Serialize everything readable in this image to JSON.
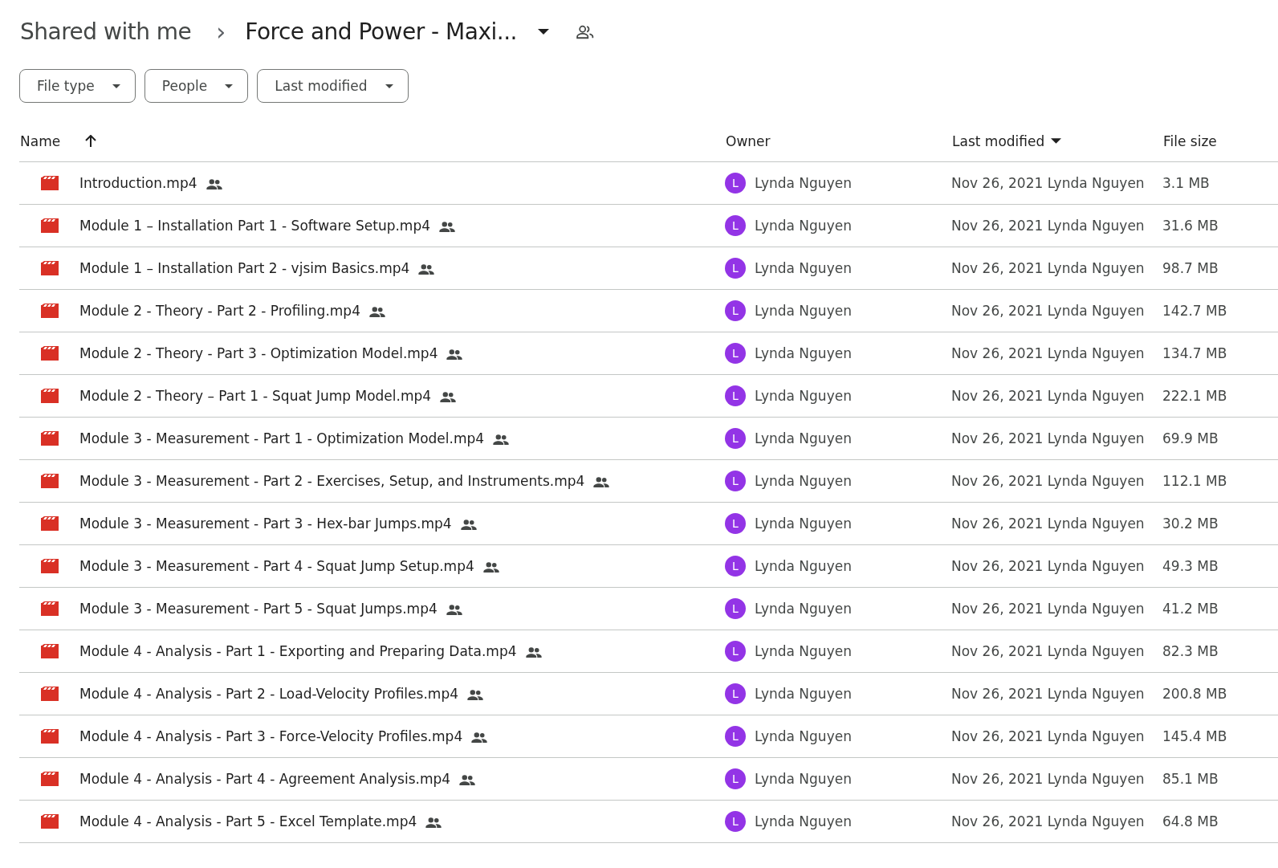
{
  "breadcrumb": {
    "parent": "Shared with me",
    "separator": "›",
    "current": "Force and Power - Maxi..."
  },
  "filters": [
    "File type",
    "People",
    "Last modified"
  ],
  "table": {
    "columns": [
      {
        "label": "Name",
        "kind": "ascending"
      },
      {
        "label": "Owner",
        "kind": "plain"
      },
      {
        "label": "Last modified",
        "kind": "descending"
      },
      {
        "label": "File size",
        "kind": "plain"
      }
    ],
    "rows": [
      {
        "name": "Introduction.mp4",
        "shared": true,
        "owner": "Lynda Nguyen",
        "owner_initial": "L",
        "modified": "Nov 26, 2021 Lynda Nguyen",
        "size": "3.1 MB"
      },
      {
        "name": "Module 1 – Installation Part 1 - Software Setup.mp4",
        "shared": true,
        "owner": "Lynda Nguyen",
        "owner_initial": "L",
        "modified": "Nov 26, 2021 Lynda Nguyen",
        "size": "31.6 MB"
      },
      {
        "name": "Module 1 – Installation Part 2 - vjsim Basics.mp4",
        "shared": true,
        "owner": "Lynda Nguyen",
        "owner_initial": "L",
        "modified": "Nov 26, 2021 Lynda Nguyen",
        "size": "98.7 MB"
      },
      {
        "name": "Module 2 - Theory - Part 2 - Profiling.mp4",
        "shared": true,
        "owner": "Lynda Nguyen",
        "owner_initial": "L",
        "modified": "Nov 26, 2021 Lynda Nguyen",
        "size": "142.7 MB"
      },
      {
        "name": "Module 2 - Theory - Part 3 - Optimization Model.mp4",
        "shared": true,
        "owner": "Lynda Nguyen",
        "owner_initial": "L",
        "modified": "Nov 26, 2021 Lynda Nguyen",
        "size": "134.7 MB"
      },
      {
        "name": "Module 2 - Theory – Part 1 - Squat Jump Model.mp4",
        "shared": true,
        "owner": "Lynda Nguyen",
        "owner_initial": "L",
        "modified": "Nov 26, 2021 Lynda Nguyen",
        "size": "222.1 MB"
      },
      {
        "name": "Module 3 - Measurement - Part 1 - Optimization Model.mp4",
        "shared": true,
        "owner": "Lynda Nguyen",
        "owner_initial": "L",
        "modified": "Nov 26, 2021 Lynda Nguyen",
        "size": "69.9 MB"
      },
      {
        "name": "Module 3 - Measurement - Part 2 - Exercises, Setup, and Instruments.mp4",
        "shared": true,
        "owner": "Lynda Nguyen",
        "owner_initial": "L",
        "modified": "Nov 26, 2021 Lynda Nguyen",
        "size": "112.1 MB"
      },
      {
        "name": "Module 3 - Measurement - Part 3 - Hex-bar Jumps.mp4",
        "shared": true,
        "owner": "Lynda Nguyen",
        "owner_initial": "L",
        "modified": "Nov 26, 2021 Lynda Nguyen",
        "size": "30.2 MB"
      },
      {
        "name": "Module 3 - Measurement - Part 4 - Squat Jump Setup.mp4",
        "shared": true,
        "owner": "Lynda Nguyen",
        "owner_initial": "L",
        "modified": "Nov 26, 2021 Lynda Nguyen",
        "size": "49.3 MB"
      },
      {
        "name": "Module 3 - Measurement - Part 5 - Squat Jumps.mp4",
        "shared": true,
        "owner": "Lynda Nguyen",
        "owner_initial": "L",
        "modified": "Nov 26, 2021 Lynda Nguyen",
        "size": "41.2 MB"
      },
      {
        "name": "Module 4 - Analysis - Part 1 - Exporting and Preparing Data.mp4",
        "shared": true,
        "owner": "Lynda Nguyen",
        "owner_initial": "L",
        "modified": "Nov 26, 2021 Lynda Nguyen",
        "size": "82.3 MB"
      },
      {
        "name": "Module 4 - Analysis - Part 2 - Load-Velocity Profiles.mp4",
        "shared": true,
        "owner": "Lynda Nguyen",
        "owner_initial": "L",
        "modified": "Nov 26, 2021 Lynda Nguyen",
        "size": "200.8 MB"
      },
      {
        "name": "Module 4 - Analysis - Part 3 - Force-Velocity Profiles.mp4",
        "shared": true,
        "owner": "Lynda Nguyen",
        "owner_initial": "L",
        "modified": "Nov 26, 2021 Lynda Nguyen",
        "size": "145.4 MB"
      },
      {
        "name": "Module 4 - Analysis - Part 4 - Agreement Analysis.mp4",
        "shared": true,
        "owner": "Lynda Nguyen",
        "owner_initial": "L",
        "modified": "Nov 26, 2021 Lynda Nguyen",
        "size": "85.1 MB"
      },
      {
        "name": "Module 4 - Analysis - Part 5 - Excel Template.mp4",
        "shared": true,
        "owner": "Lynda Nguyen",
        "owner_initial": "L",
        "modified": "Nov 26, 2021 Lynda Nguyen",
        "size": "64.8 MB"
      }
    ]
  }
}
